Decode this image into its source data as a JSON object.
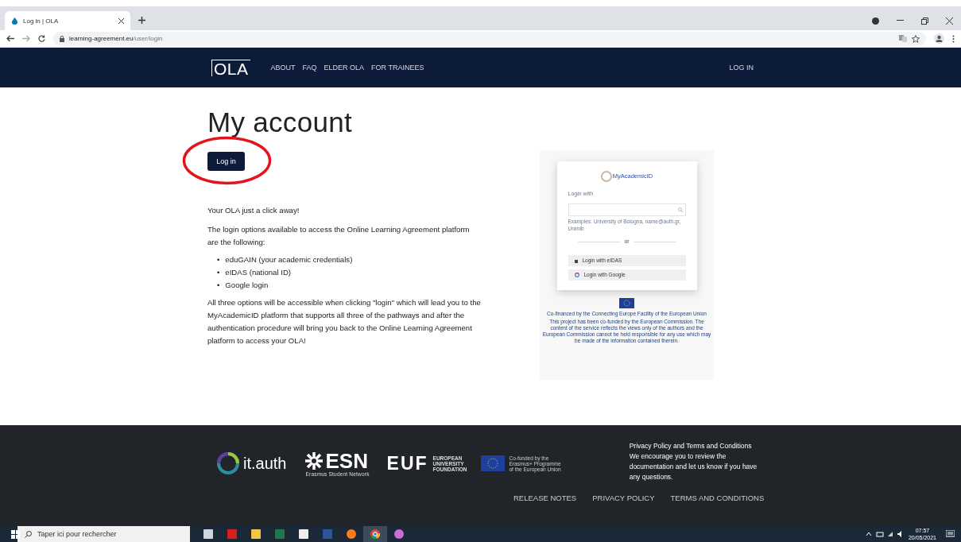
{
  "browser": {
    "tab_title": "Log in | OLA",
    "url_domain": "learning-agreement.eu",
    "url_path": "/user/login"
  },
  "nav": {
    "logo": "OLA",
    "links": [
      "ABOUT",
      "FAQ",
      "ELDER OLA",
      "FOR TRAINEES"
    ],
    "login": "LOG IN"
  },
  "main": {
    "title": "My account",
    "button": "Log in",
    "intro": "Your OLA just a click away!",
    "options_text": "The login options available to access the Online Learning Agreement platform are the following:",
    "bullet": "•",
    "options": [
      "eduGAIN (your academic credentials)",
      "eIDAS (national ID)",
      "Google login"
    ],
    "closing": "All three options will be accessible when clicking \"login\" which will lead you to the MyAcademicID platform that supports all three of the pathways and after the authentication procedure will bring you back to the Online Learning Agreement platform to access your OLA!"
  },
  "preview": {
    "logo": "MyAcademicID",
    "login_with": "Login with",
    "examples": "Examples: University of Bologna, name@auth.gr, Unimib",
    "separator": "or",
    "buttons": [
      {
        "kind": "eidas",
        "label": "Login with eIDAS"
      },
      {
        "kind": "google",
        "label": "Login with Google"
      }
    ],
    "cofinanced": "Co-financed by the Connecting Europe Facility of the European Union",
    "disclaimer": "This project has been co-funded by the European Commission. The content of the service reflects the views only of the authors and the European Commission cannot be held responsible for any use which may be made of the information contained therein."
  },
  "footer": {
    "itauth": "it.auth",
    "esn": "ESN",
    "esn_sub": "Erasmus Student Network",
    "euf": "EUF",
    "euf_lines": [
      "EUROPEAN",
      "UNIVERSITY",
      "FOUNDATION"
    ],
    "eu_lines": [
      "Co-funded by the",
      "Erasmus+ Programme",
      "of the European Union"
    ],
    "policy_title": "Privacy Policy and Terms and Conditions",
    "policy_text": "We encourage you to review the documentation and let us know if you have any questions.",
    "links": [
      "RELEASE NOTES",
      "PRIVACY POLICY",
      "TERMS AND CONDITIONS"
    ]
  },
  "taskbar": {
    "search_placeholder": "Taper ici pour rechercher",
    "apps": [
      {
        "kind": "taskview",
        "selected": false
      },
      {
        "kind": "pdf",
        "selected": false
      },
      {
        "kind": "folder",
        "selected": false
      },
      {
        "kind": "excel",
        "selected": false
      },
      {
        "kind": "zip",
        "selected": false
      },
      {
        "kind": "word",
        "selected": false
      },
      {
        "kind": "firefox",
        "selected": false
      },
      {
        "kind": "chrome",
        "selected": true
      },
      {
        "kind": "paint",
        "selected": false
      }
    ],
    "time": "07:57",
    "date": "20/05/2021"
  }
}
